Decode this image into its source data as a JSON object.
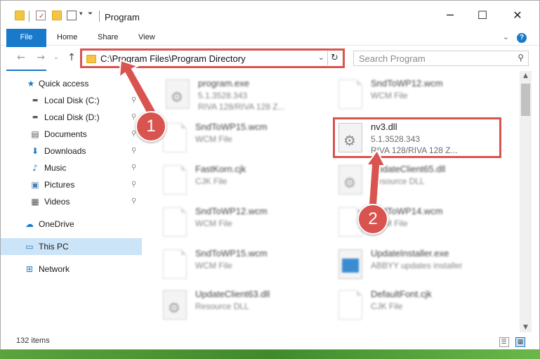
{
  "window": {
    "title": "Program",
    "controls": {
      "minimize": "─",
      "maximize": "☐",
      "close": "✕"
    }
  },
  "ribbon": {
    "tabs": [
      "File",
      "Home",
      "Share",
      "View"
    ],
    "expand": "⌄",
    "help": "?"
  },
  "nav": {
    "back": "←",
    "forward": "→",
    "recent": "⌄",
    "up": "↑",
    "address": "C:\\Program Files\\Program Directory",
    "address_dropdown": "⌄",
    "refresh": "↻",
    "search_placeholder": "Search Program",
    "search_icon": "search-icon"
  },
  "sidebar": {
    "items": [
      {
        "label": "Quick access",
        "icon": "★",
        "icon_color": "#1979ca",
        "pinned": false
      },
      {
        "label": "Local Disk (C:)",
        "icon": "▬",
        "icon_color": "#5a5a5a",
        "pinned": true
      },
      {
        "label": "Local Disk (D:)",
        "icon": "▬",
        "icon_color": "#5a5a5a",
        "pinned": true
      },
      {
        "label": "Documents",
        "icon": "▤",
        "icon_color": "#5a5a5a",
        "pinned": true
      },
      {
        "label": "Downloads",
        "icon": "⬇",
        "icon_color": "#1979ca",
        "pinned": true
      },
      {
        "label": "Music",
        "icon": "♪",
        "icon_color": "#1979ca",
        "pinned": true
      },
      {
        "label": "Pictures",
        "icon": "▣",
        "icon_color": "#4a7fb5",
        "pinned": true
      },
      {
        "label": "Videos",
        "icon": "▦",
        "icon_color": "#555555",
        "pinned": true
      },
      {
        "label": "OneDrive",
        "icon": "☁",
        "icon_color": "#1979ca",
        "pinned": false
      },
      {
        "label": "This PC",
        "icon": "▭",
        "icon_color": "#1979ca",
        "pinned": false
      },
      {
        "label": "Network",
        "icon": "⊞",
        "icon_color": "#1979ca",
        "pinned": false
      }
    ],
    "pin_glyph": "📌"
  },
  "files": [
    {
      "name": "program.exe",
      "line2": "5.1.3528.343",
      "line3": "RIVA 128/RIVA 128 Z...",
      "kind": "exe"
    },
    {
      "name": "SndToWP12.wcm",
      "line2": "WCM File",
      "line3": "",
      "kind": "doc"
    },
    {
      "name": "SndToWP15.wcm",
      "line2": "WCM File",
      "line3": "",
      "kind": "doc"
    },
    {
      "name": "nv3.dll",
      "line2": "5.1.3528.343",
      "line3": "RIVA 128/RIVA 128 Z...",
      "kind": "dll"
    },
    {
      "name": "FastKorn.cjk",
      "line2": "CJK File",
      "line3": "",
      "kind": "doc"
    },
    {
      "name": "UpdateClient65.dll",
      "line2": "Resource DLL",
      "line3": "",
      "kind": "dll"
    },
    {
      "name": "SndToWP12.wcm",
      "line2": "WCM File",
      "line3": "",
      "kind": "doc"
    },
    {
      "name": "SndToWP14.wcm",
      "line2": "WCM File",
      "line3": "",
      "kind": "doc"
    },
    {
      "name": "SndToWP15.wcm",
      "line2": "WCM File",
      "line3": "",
      "kind": "doc"
    },
    {
      "name": "UpdateInstaller.exe",
      "line2": "ABBYY updates installer",
      "line3": "",
      "kind": "exe2"
    },
    {
      "name": "UpdateClient63.dll",
      "line2": "Resource DLL",
      "line3": "",
      "kind": "dll"
    },
    {
      "name": "DefaultFont.cjk",
      "line2": "CJK File",
      "line3": "",
      "kind": "doc"
    }
  ],
  "status": {
    "item_count": "132 items",
    "view_details": "☰",
    "view_tiles": "▦"
  },
  "annotations": {
    "step1": "1",
    "step2": "2",
    "color": "#d9534f"
  },
  "scroll": {
    "up": "▲",
    "down": "▼"
  }
}
